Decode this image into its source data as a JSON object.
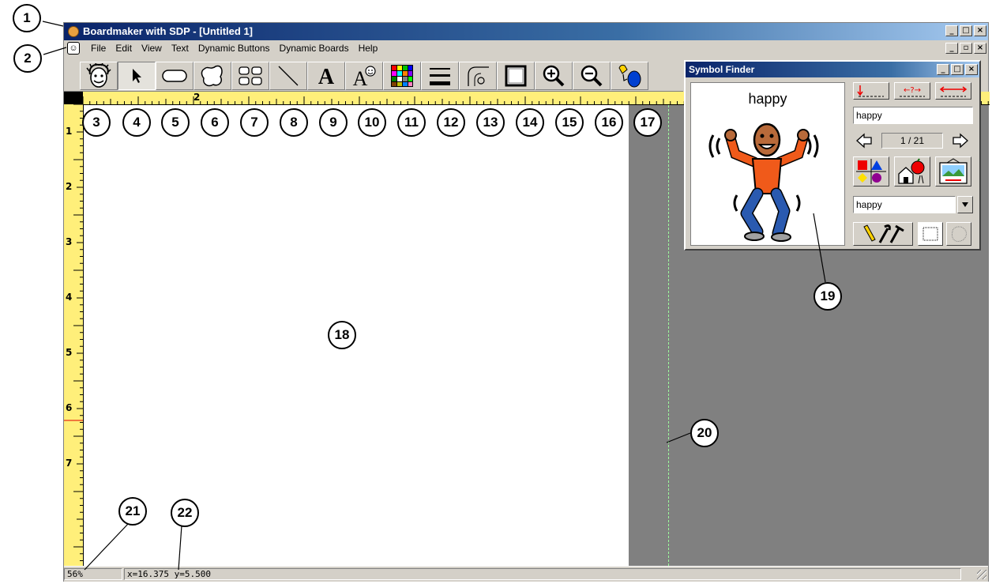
{
  "window": {
    "title": "Boardmaker with SDP - [Untitled 1]",
    "controls": {
      "minimize": "_",
      "maximize": "□",
      "close": "×",
      "restore": "▫"
    }
  },
  "menu": {
    "items": [
      "File",
      "Edit",
      "View",
      "Text",
      "Dynamic Buttons",
      "Dynamic Boards",
      "Help"
    ]
  },
  "toolbar": {
    "tools": [
      {
        "name": "symbol-finder-tool",
        "icon": "face-icon"
      },
      {
        "name": "pointer-tool",
        "icon": "arrow-pointer-icon"
      },
      {
        "name": "button-tool",
        "icon": "rounded-rect-icon"
      },
      {
        "name": "freeform-button-tool",
        "icon": "blob-shape-icon"
      },
      {
        "name": "button-sequencer-tool",
        "icon": "grid-icon"
      },
      {
        "name": "line-tool",
        "icon": "line-icon"
      },
      {
        "name": "text-tool",
        "icon": "letter-a-icon"
      },
      {
        "name": "symbol-name-tool",
        "icon": "letter-a-face-icon"
      },
      {
        "name": "color-tool",
        "icon": "color-palette-icon"
      },
      {
        "name": "line-thickness-tool",
        "icon": "line-thickness-icon"
      },
      {
        "name": "corner-radius-tool",
        "icon": "corner-radius-icon"
      },
      {
        "name": "frame-tool",
        "icon": "frame-icon"
      },
      {
        "name": "zoom-in-tool",
        "icon": "zoom-in-icon"
      },
      {
        "name": "zoom-out-tool",
        "icon": "zoom-out-icon"
      },
      {
        "name": "paint-bucket-tool",
        "icon": "bucket-icon"
      }
    ]
  },
  "rulers": {
    "vertical_numbers": [
      "1",
      "2",
      "3",
      "4",
      "5",
      "6",
      "7"
    ],
    "horizontal_numbers": [
      "2"
    ]
  },
  "symbol_finder": {
    "title": "Symbol Finder",
    "word": "happy",
    "search_text": "happy",
    "page_indicator": "1 / 21",
    "category_value": "happy"
  },
  "status": {
    "zoom": "56%",
    "coords": "x=16.375  y=5.500"
  },
  "callouts": [
    "1",
    "2",
    "3",
    "4",
    "5",
    "6",
    "7",
    "8",
    "9",
    "10",
    "11",
    "12",
    "13",
    "14",
    "15",
    "16",
    "17",
    "18",
    "19",
    "20",
    "21",
    "22"
  ],
  "colors": {
    "titlebar": "#0a246a",
    "ruler": "#ffef7a",
    "pasteboard": "#808080",
    "face": "#d4d0c8"
  }
}
